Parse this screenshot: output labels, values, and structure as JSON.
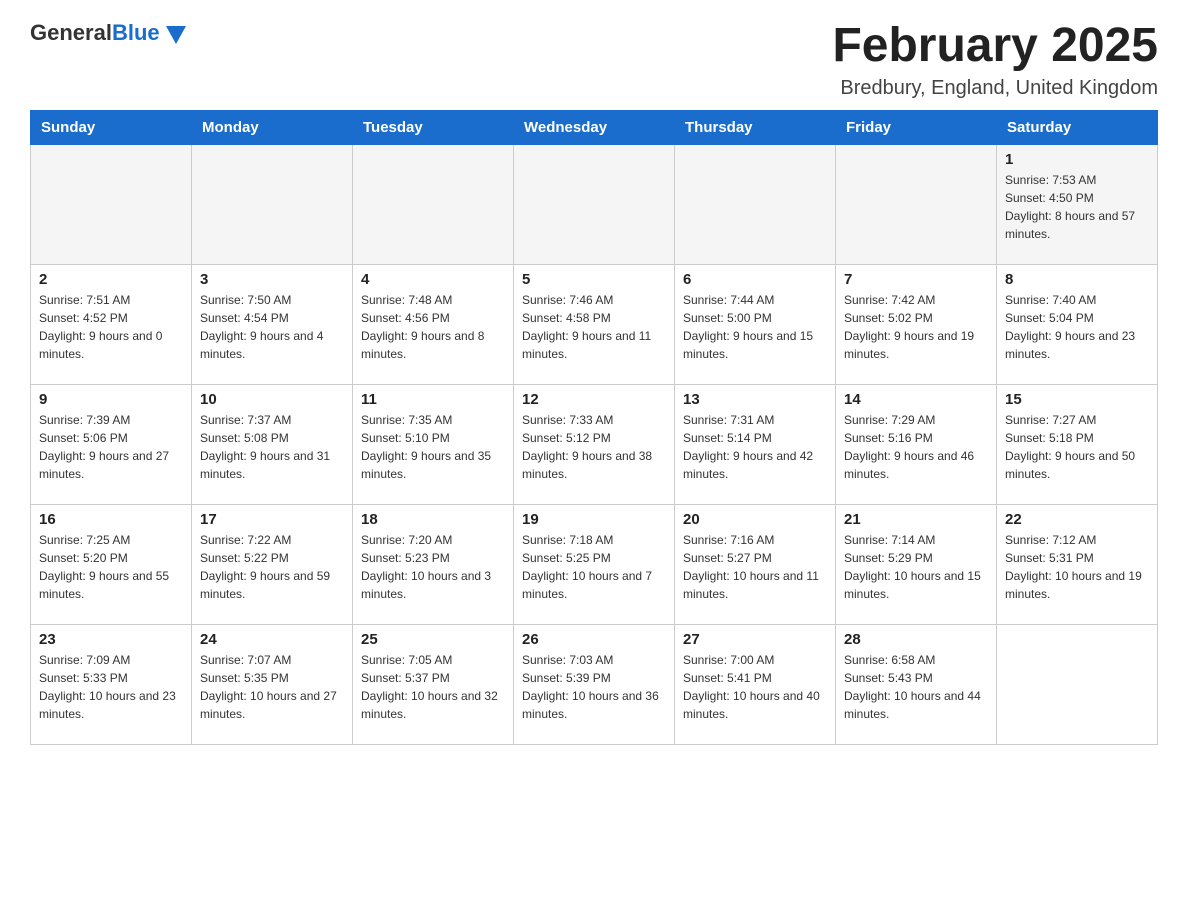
{
  "logo": {
    "general": "General",
    "blue": "Blue"
  },
  "header": {
    "title": "February 2025",
    "location": "Bredbury, England, United Kingdom"
  },
  "days_of_week": [
    "Sunday",
    "Monday",
    "Tuesday",
    "Wednesday",
    "Thursday",
    "Friday",
    "Saturday"
  ],
  "weeks": [
    [
      {
        "day": "",
        "sunrise": "",
        "sunset": "",
        "daylight": ""
      },
      {
        "day": "",
        "sunrise": "",
        "sunset": "",
        "daylight": ""
      },
      {
        "day": "",
        "sunrise": "",
        "sunset": "",
        "daylight": ""
      },
      {
        "day": "",
        "sunrise": "",
        "sunset": "",
        "daylight": ""
      },
      {
        "day": "",
        "sunrise": "",
        "sunset": "",
        "daylight": ""
      },
      {
        "day": "",
        "sunrise": "",
        "sunset": "",
        "daylight": ""
      },
      {
        "day": "1",
        "sunrise": "Sunrise: 7:53 AM",
        "sunset": "Sunset: 4:50 PM",
        "daylight": "Daylight: 8 hours and 57 minutes."
      }
    ],
    [
      {
        "day": "2",
        "sunrise": "Sunrise: 7:51 AM",
        "sunset": "Sunset: 4:52 PM",
        "daylight": "Daylight: 9 hours and 0 minutes."
      },
      {
        "day": "3",
        "sunrise": "Sunrise: 7:50 AM",
        "sunset": "Sunset: 4:54 PM",
        "daylight": "Daylight: 9 hours and 4 minutes."
      },
      {
        "day": "4",
        "sunrise": "Sunrise: 7:48 AM",
        "sunset": "Sunset: 4:56 PM",
        "daylight": "Daylight: 9 hours and 8 minutes."
      },
      {
        "day": "5",
        "sunrise": "Sunrise: 7:46 AM",
        "sunset": "Sunset: 4:58 PM",
        "daylight": "Daylight: 9 hours and 11 minutes."
      },
      {
        "day": "6",
        "sunrise": "Sunrise: 7:44 AM",
        "sunset": "Sunset: 5:00 PM",
        "daylight": "Daylight: 9 hours and 15 minutes."
      },
      {
        "day": "7",
        "sunrise": "Sunrise: 7:42 AM",
        "sunset": "Sunset: 5:02 PM",
        "daylight": "Daylight: 9 hours and 19 minutes."
      },
      {
        "day": "8",
        "sunrise": "Sunrise: 7:40 AM",
        "sunset": "Sunset: 5:04 PM",
        "daylight": "Daylight: 9 hours and 23 minutes."
      }
    ],
    [
      {
        "day": "9",
        "sunrise": "Sunrise: 7:39 AM",
        "sunset": "Sunset: 5:06 PM",
        "daylight": "Daylight: 9 hours and 27 minutes."
      },
      {
        "day": "10",
        "sunrise": "Sunrise: 7:37 AM",
        "sunset": "Sunset: 5:08 PM",
        "daylight": "Daylight: 9 hours and 31 minutes."
      },
      {
        "day": "11",
        "sunrise": "Sunrise: 7:35 AM",
        "sunset": "Sunset: 5:10 PM",
        "daylight": "Daylight: 9 hours and 35 minutes."
      },
      {
        "day": "12",
        "sunrise": "Sunrise: 7:33 AM",
        "sunset": "Sunset: 5:12 PM",
        "daylight": "Daylight: 9 hours and 38 minutes."
      },
      {
        "day": "13",
        "sunrise": "Sunrise: 7:31 AM",
        "sunset": "Sunset: 5:14 PM",
        "daylight": "Daylight: 9 hours and 42 minutes."
      },
      {
        "day": "14",
        "sunrise": "Sunrise: 7:29 AM",
        "sunset": "Sunset: 5:16 PM",
        "daylight": "Daylight: 9 hours and 46 minutes."
      },
      {
        "day": "15",
        "sunrise": "Sunrise: 7:27 AM",
        "sunset": "Sunset: 5:18 PM",
        "daylight": "Daylight: 9 hours and 50 minutes."
      }
    ],
    [
      {
        "day": "16",
        "sunrise": "Sunrise: 7:25 AM",
        "sunset": "Sunset: 5:20 PM",
        "daylight": "Daylight: 9 hours and 55 minutes."
      },
      {
        "day": "17",
        "sunrise": "Sunrise: 7:22 AM",
        "sunset": "Sunset: 5:22 PM",
        "daylight": "Daylight: 9 hours and 59 minutes."
      },
      {
        "day": "18",
        "sunrise": "Sunrise: 7:20 AM",
        "sunset": "Sunset: 5:23 PM",
        "daylight": "Daylight: 10 hours and 3 minutes."
      },
      {
        "day": "19",
        "sunrise": "Sunrise: 7:18 AM",
        "sunset": "Sunset: 5:25 PM",
        "daylight": "Daylight: 10 hours and 7 minutes."
      },
      {
        "day": "20",
        "sunrise": "Sunrise: 7:16 AM",
        "sunset": "Sunset: 5:27 PM",
        "daylight": "Daylight: 10 hours and 11 minutes."
      },
      {
        "day": "21",
        "sunrise": "Sunrise: 7:14 AM",
        "sunset": "Sunset: 5:29 PM",
        "daylight": "Daylight: 10 hours and 15 minutes."
      },
      {
        "day": "22",
        "sunrise": "Sunrise: 7:12 AM",
        "sunset": "Sunset: 5:31 PM",
        "daylight": "Daylight: 10 hours and 19 minutes."
      }
    ],
    [
      {
        "day": "23",
        "sunrise": "Sunrise: 7:09 AM",
        "sunset": "Sunset: 5:33 PM",
        "daylight": "Daylight: 10 hours and 23 minutes."
      },
      {
        "day": "24",
        "sunrise": "Sunrise: 7:07 AM",
        "sunset": "Sunset: 5:35 PM",
        "daylight": "Daylight: 10 hours and 27 minutes."
      },
      {
        "day": "25",
        "sunrise": "Sunrise: 7:05 AM",
        "sunset": "Sunset: 5:37 PM",
        "daylight": "Daylight: 10 hours and 32 minutes."
      },
      {
        "day": "26",
        "sunrise": "Sunrise: 7:03 AM",
        "sunset": "Sunset: 5:39 PM",
        "daylight": "Daylight: 10 hours and 36 minutes."
      },
      {
        "day": "27",
        "sunrise": "Sunrise: 7:00 AM",
        "sunset": "Sunset: 5:41 PM",
        "daylight": "Daylight: 10 hours and 40 minutes."
      },
      {
        "day": "28",
        "sunrise": "Sunrise: 6:58 AM",
        "sunset": "Sunset: 5:43 PM",
        "daylight": "Daylight: 10 hours and 44 minutes."
      },
      {
        "day": "",
        "sunrise": "",
        "sunset": "",
        "daylight": ""
      }
    ]
  ]
}
